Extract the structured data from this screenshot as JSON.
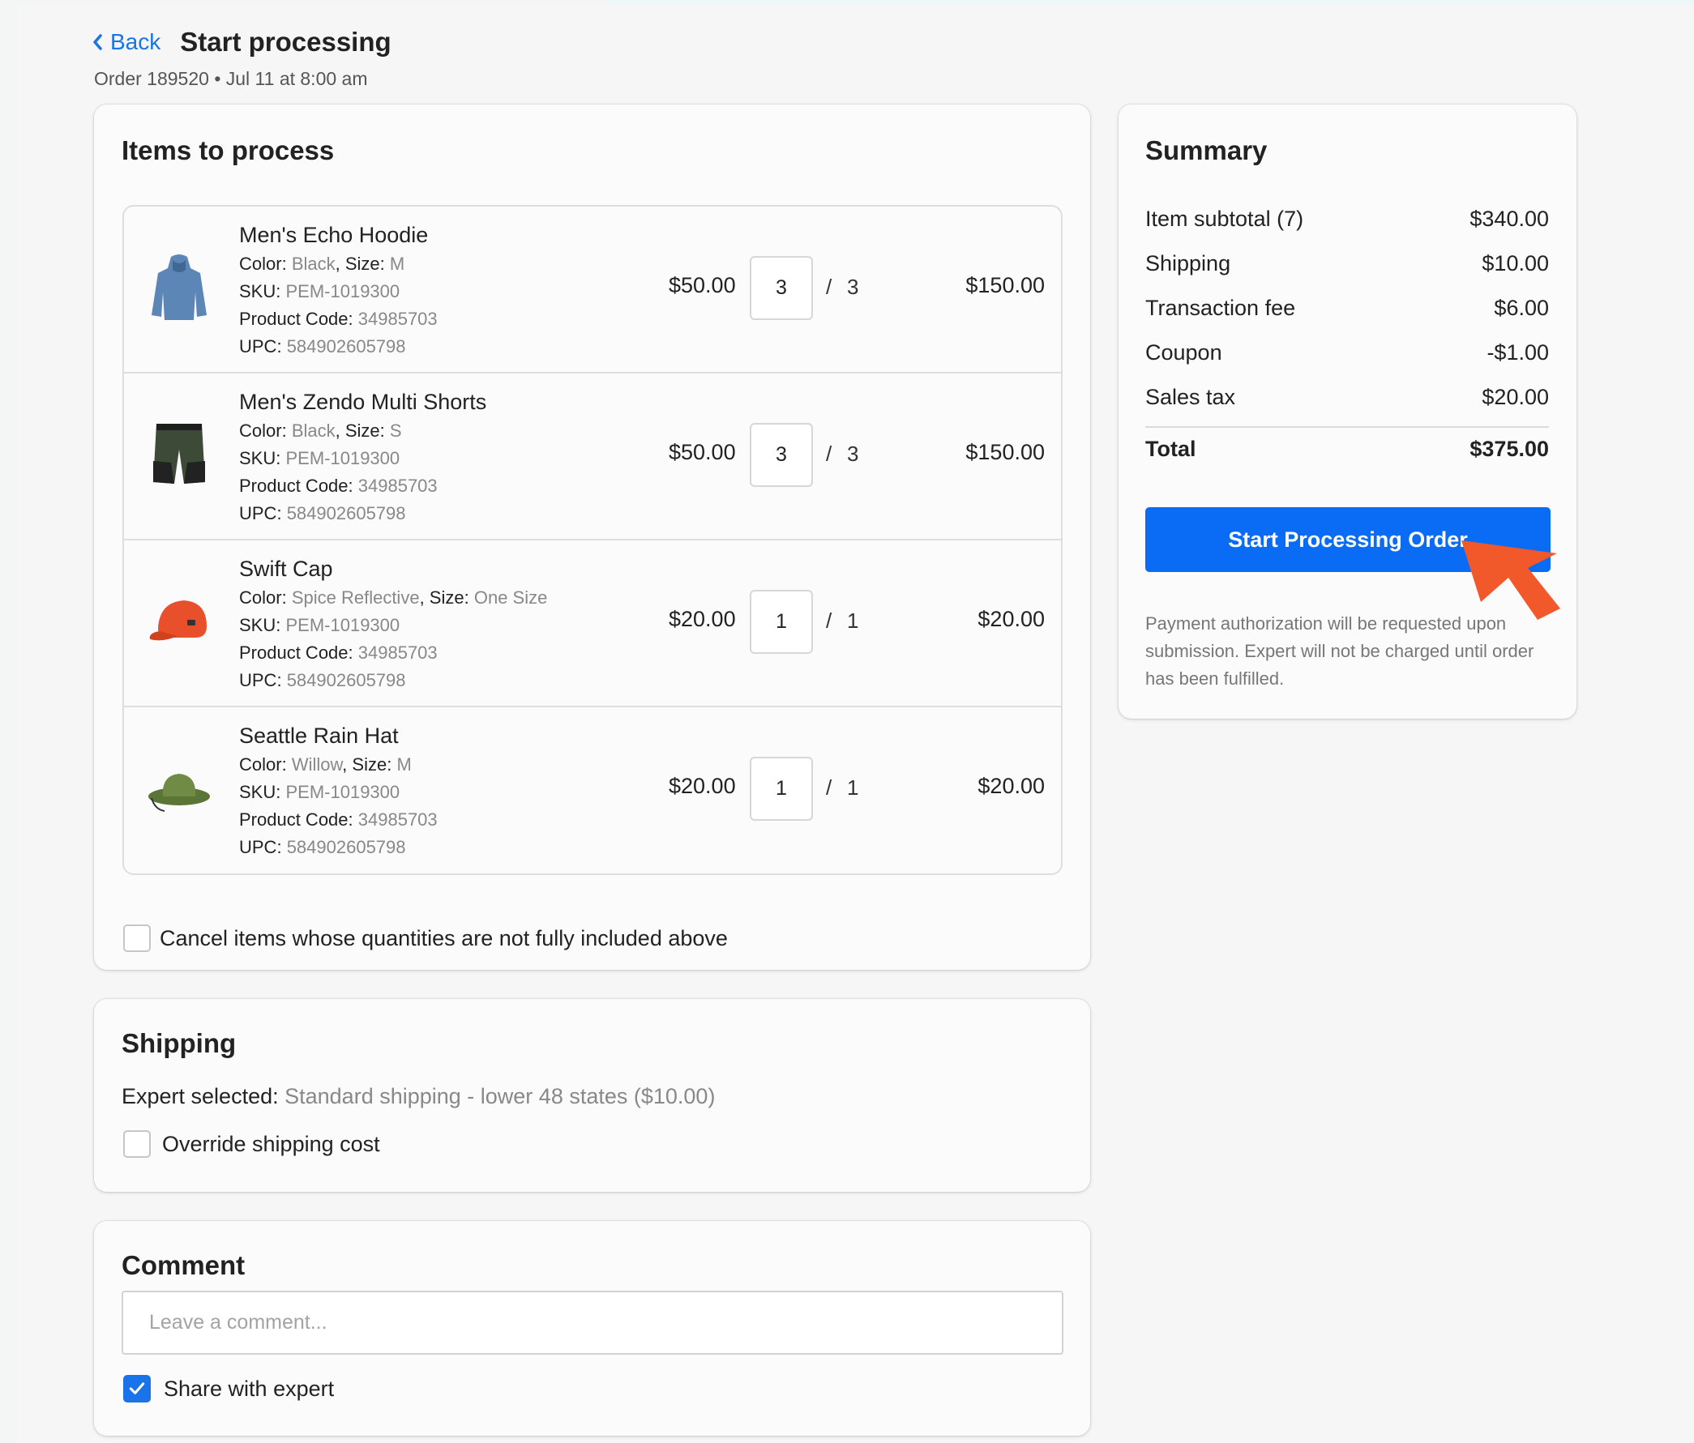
{
  "header": {
    "back_label": "Back",
    "title": "Start processing",
    "order_meta": "Order 189520 • Jul 11 at 8:00 am"
  },
  "items_card": {
    "title": "Items to process",
    "attr_labels": {
      "color": "Color:",
      "size": "Size:",
      "sku": "SKU:",
      "product_code": "Product Code:",
      "upc": "UPC:"
    },
    "qty_separator": "/",
    "items": [
      {
        "name": "Men's Echo Hoodie",
        "color": "Black",
        "size": "M",
        "sku": "PEM-1019300",
        "product_code": "34985703",
        "upc": "584902605798",
        "price": "$50.00",
        "qty": "3",
        "qty_total": "3",
        "total": "$150.00",
        "icon": "hoodie-icon",
        "icon_color": "#5b86b5"
      },
      {
        "name": "Men's Zendo Multi Shorts",
        "color": "Black",
        "size": "S",
        "sku": "PEM-1019300",
        "product_code": "34985703",
        "upc": "584902605798",
        "price": "$50.00",
        "qty": "3",
        "qty_total": "3",
        "total": "$150.00",
        "icon": "shorts-icon",
        "icon_color": "#3c4a37"
      },
      {
        "name": "Swift Cap",
        "color": "Spice Reflective",
        "size": "One Size",
        "sku": "PEM-1019300",
        "product_code": "34985703",
        "upc": "584902605798",
        "price": "$20.00",
        "qty": "1",
        "qty_total": "1",
        "total": "$20.00",
        "icon": "cap-icon",
        "icon_color": "#e8502c"
      },
      {
        "name": "Seattle Rain Hat",
        "color": "Willow",
        "size": "M",
        "sku": "PEM-1019300",
        "product_code": "34985703",
        "upc": "584902605798",
        "price": "$20.00",
        "qty": "1",
        "qty_total": "1",
        "total": "$20.00",
        "icon": "hat-icon",
        "icon_color": "#6f8b45"
      }
    ],
    "cancel_label": "Cancel items whose quantities are not fully included above",
    "cancel_checked": false
  },
  "shipping_card": {
    "title": "Shipping",
    "expert_label": "Expert selected:",
    "expert_value": "Standard shipping - lower 48 states ($10.00)",
    "override_label": "Override shipping cost",
    "override_checked": false
  },
  "comment_card": {
    "title": "Comment",
    "placeholder": "Leave a comment...",
    "value": "",
    "share_label": "Share with expert",
    "share_checked": true
  },
  "summary_card": {
    "title": "Summary",
    "rows": [
      {
        "label": "Item subtotal (7)",
        "value": "$340.00"
      },
      {
        "label": "Shipping",
        "value": "$10.00"
      },
      {
        "label": "Transaction fee",
        "value": "$6.00"
      },
      {
        "label": "Coupon",
        "value": "-$1.00"
      },
      {
        "label": "Sales tax",
        "value": "$20.00"
      }
    ],
    "total_label": "Total",
    "total_value": "$375.00",
    "button_label": "Start Processing Order",
    "note": "Payment authorization will be requested upon submission. Expert will not be charged until order has been fulfilled."
  },
  "colors": {
    "accent": "#0a6cf5",
    "link": "#1a73e8",
    "cursor": "#f1592a",
    "page_bg": "#f6f6f6",
    "card_bg": "#fbfbfb"
  }
}
